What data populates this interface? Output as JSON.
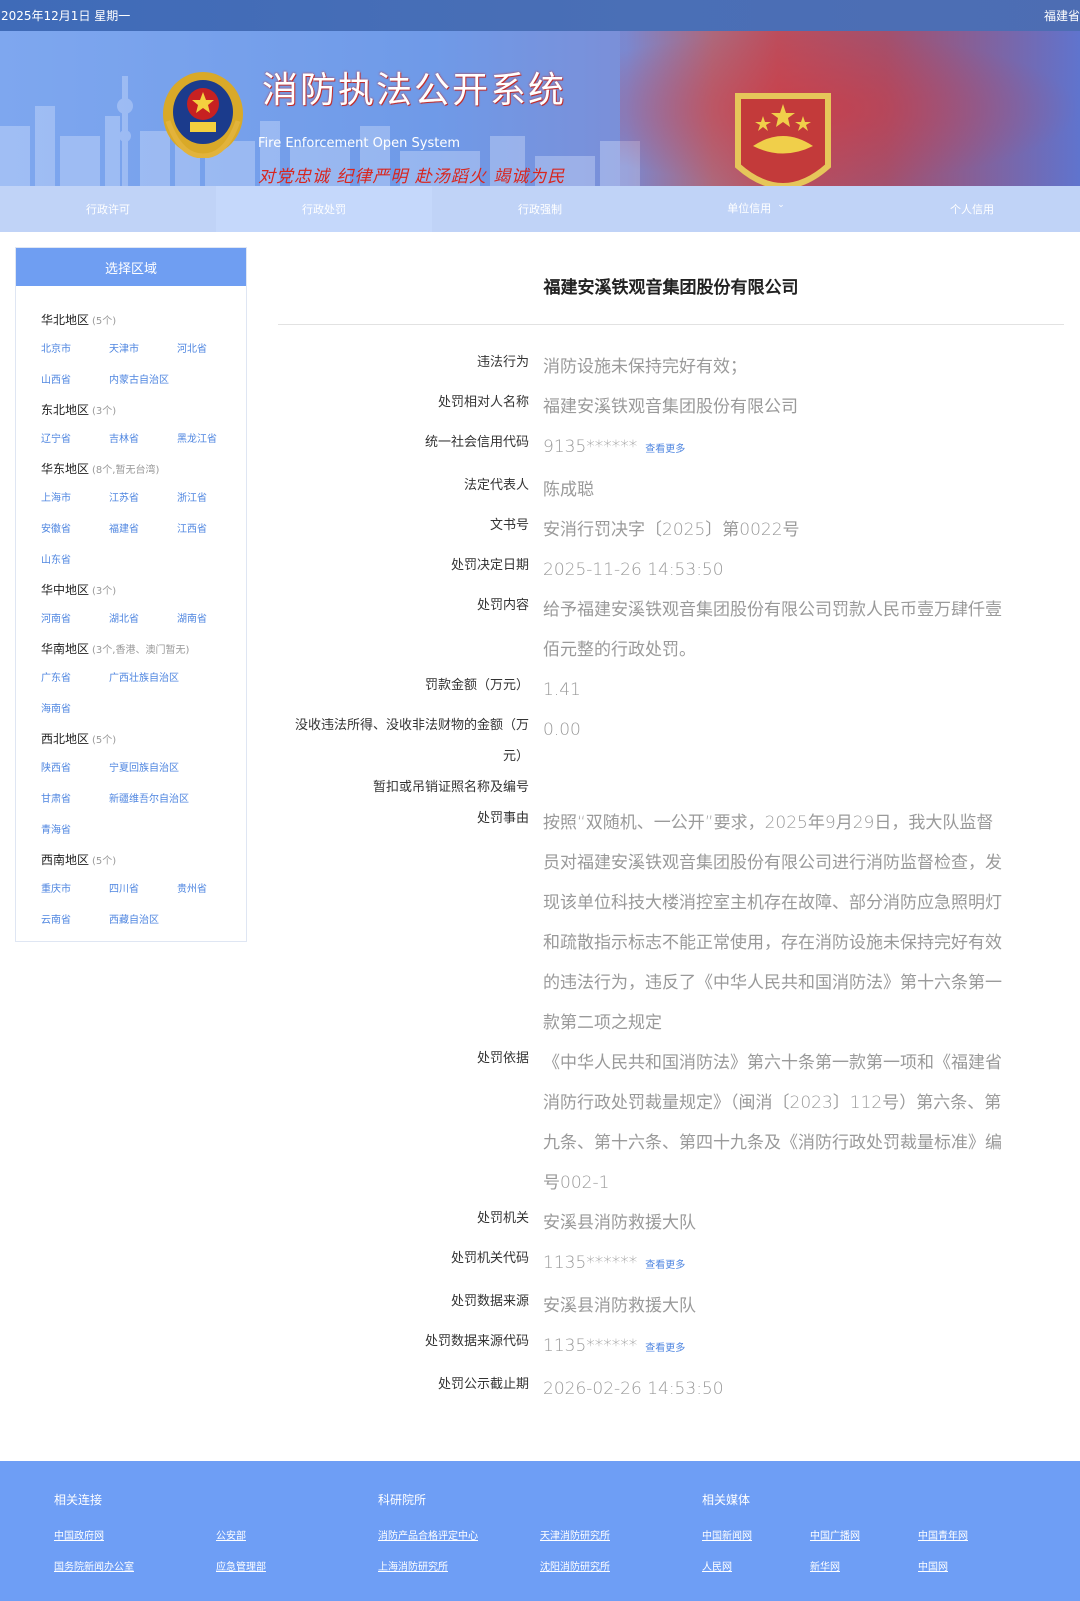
{
  "topbar": {
    "date": "2025年12月1日 星期一",
    "region": "福建省"
  },
  "banner": {
    "title": "消防执法公开系统",
    "subtitle": "Fire Enforcement Open System",
    "motto": "对党忠诚 纪律严明 赴汤蹈火 竭诚为民"
  },
  "nav": {
    "items": [
      {
        "label": "行政许可"
      },
      {
        "label": "行政处罚"
      },
      {
        "label": "行政强制"
      },
      {
        "label": "单位信用"
      },
      {
        "label": "个人信用"
      }
    ]
  },
  "sidebar": {
    "title": "选择区域",
    "groups": [
      {
        "name": "华北地区",
        "count": "(5个)",
        "cities": [
          "北京市",
          "天津市",
          "河北省",
          "山西省",
          "内蒙古自治区"
        ]
      },
      {
        "name": "东北地区",
        "count": "(3个)",
        "cities": [
          "辽宁省",
          "吉林省",
          "黑龙江省"
        ]
      },
      {
        "name": "华东地区",
        "count": "(8个,暂无台湾)",
        "cities": [
          "上海市",
          "江苏省",
          "浙江省",
          "安徽省",
          "福建省",
          "江西省",
          "山东省"
        ]
      },
      {
        "name": "华中地区",
        "count": "(3个)",
        "cities": [
          "河南省",
          "湖北省",
          "湖南省"
        ]
      },
      {
        "name": "华南地区",
        "count": "(3个,香港、澳门暂无)",
        "cities": [
          "广东省",
          "广西壮族自治区",
          "海南省"
        ]
      },
      {
        "name": "西北地区",
        "count": "(5个)",
        "cities": [
          "陕西省",
          "宁夏回族自治区",
          "甘肃省",
          "新疆维吾尔自治区",
          "青海省"
        ]
      },
      {
        "name": "西南地区",
        "count": "(5个)",
        "cities": [
          "重庆市",
          "四川省",
          "贵州省",
          "云南省",
          "西藏自治区"
        ]
      }
    ]
  },
  "main": {
    "company": "福建安溪铁观音集团股份有限公司",
    "more_label": "查看更多",
    "rows": [
      {
        "label": "违法行为",
        "value": "消防设施未保持完好有效；"
      },
      {
        "label": "处罚相对人名称",
        "value": "福建安溪铁观音集团股份有限公司"
      },
      {
        "label": "统一社会信用代码",
        "value": "9135******",
        "more": true
      },
      {
        "label": "法定代表人",
        "value": "陈成聪"
      },
      {
        "label": "文书号",
        "value": "安消行罚决字〔2025〕第0022号"
      },
      {
        "label": "处罚决定日期",
        "value": "2025-11-26 14:53:50"
      },
      {
        "label": "处罚内容",
        "value": "给予福建安溪铁观音集团股份有限公司罚款人民币壹万肆仟壹佰元整的行政处罚。"
      },
      {
        "label": "罚款金额（万元）",
        "value": "1.41"
      },
      {
        "label": "没收违法所得、没收非法财物的金额（万元）",
        "value": "0.00"
      },
      {
        "label": "暂扣或吊销证照名称及编号",
        "value": ""
      },
      {
        "label": "处罚事由",
        "value": "按照“双随机、一公开”要求，2025年9月29日，我大队监督员对福建安溪铁观音集团股份有限公司进行消防监督检查，发现该单位科技大楼消控室主机存在故障、部分消防应急照明灯和疏散指示标志不能正常使用，存在消防设施未保持完好有效的违法行为，违反了《中华人民共和国消防法》第十六条第一款第二项之规定"
      },
      {
        "label": "处罚依据",
        "value": "《中华人民共和国消防法》第六十条第一款第一项和《福建省消防行政处罚裁量规定》（闽消〔2023〕112号）第六条、第九条、第十六条、第四十九条及《消防行政处罚裁量标准》编号002-1"
      },
      {
        "label": "处罚机关",
        "value": "安溪县消防救援大队"
      },
      {
        "label": "处罚机关代码",
        "value": "1135******",
        "more": true
      },
      {
        "label": "处罚数据来源",
        "value": "安溪县消防救援大队"
      },
      {
        "label": "处罚数据来源代码",
        "value": "1135******",
        "more": true
      },
      {
        "label": "处罚公示截止期",
        "value": "2026-02-26 14:53:50"
      }
    ]
  },
  "footer": {
    "columns": [
      {
        "title": "相关连接",
        "links": [
          "中国政府网",
          "公安部",
          "国务院新闻办公室",
          "应急管理部"
        ]
      },
      {
        "title": "科研院所",
        "links": [
          "消防产品合格评定中心",
          "天津消防研究所",
          "上海消防研究所",
          "沈阳消防研究所"
        ]
      },
      {
        "title": "相关媒体",
        "links": [
          "中国新闻网",
          "中国广播网",
          "中国青年网",
          "人民网",
          "新华网",
          "中国网"
        ]
      }
    ]
  },
  "colors": {
    "accent": "#6f9ef2",
    "link": "#4f86e0",
    "footer": "#6e9ef5"
  }
}
